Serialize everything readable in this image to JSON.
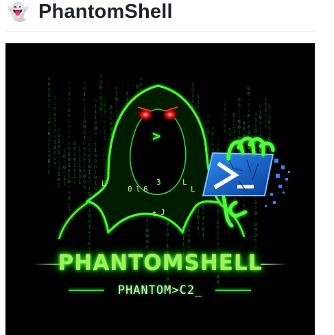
{
  "header": {
    "icon": "ghost-emoji-icon",
    "title": "PhantomShell"
  },
  "banner": {
    "wordmark": "PHANTOMSHELL",
    "tagline": "PHANTOM>C2_",
    "terminal_prompt": ">",
    "code_glyphs": [
      "L",
      "3",
      "L",
      "0",
      "l",
      "6",
      "L",
      "t",
      "J"
    ],
    "colors": {
      "background": "#000000",
      "neon_green": "#39ff14",
      "eyes": "#ff1a1a",
      "powershell_blue": "#1e6fd0"
    },
    "icons": [
      "hooded-hacker-figure",
      "powershell-logo-icon",
      "green-claw-hand-icon"
    ]
  }
}
